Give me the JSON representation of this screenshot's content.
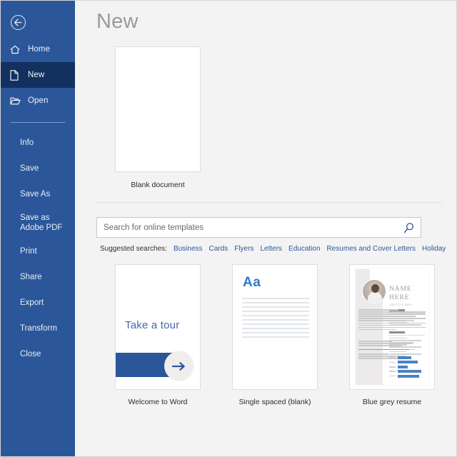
{
  "sidebar": {
    "back": {
      "label": "Back",
      "icon": "back-arrow-icon"
    },
    "main_items": [
      {
        "label": "Home",
        "icon": "home-icon",
        "selected": false
      },
      {
        "label": "New",
        "icon": "new-document-icon",
        "selected": true
      },
      {
        "label": "Open",
        "icon": "open-folder-icon",
        "selected": false
      }
    ],
    "sub_items": [
      {
        "label": "Info"
      },
      {
        "label": "Save"
      },
      {
        "label": "Save As"
      },
      {
        "label": "Save as Adobe PDF"
      },
      {
        "label": "Print"
      },
      {
        "label": "Share"
      },
      {
        "label": "Export"
      },
      {
        "label": "Transform"
      },
      {
        "label": "Close"
      }
    ],
    "accent_color": "#2b579a",
    "selected_color": "#12315e"
  },
  "main": {
    "title": "New",
    "blank_document": {
      "caption": "Blank document"
    },
    "search": {
      "placeholder": "Search for online templates",
      "value": "",
      "icon": "search-icon"
    },
    "suggested": {
      "label": "Suggested searches:",
      "items": [
        "Business",
        "Cards",
        "Flyers",
        "Letters",
        "Education",
        "Resumes and Cover Letters",
        "Holiday"
      ],
      "link_color": "#2b579a"
    },
    "templates": [
      {
        "caption": "Welcome to Word",
        "tour_text": "Take a tour",
        "arrow_icon": "arrow-right-icon"
      },
      {
        "caption": "Single spaced (blank)",
        "sample_text": "Aa"
      },
      {
        "caption": "Blue grey resume",
        "name_line1": "NAME",
        "name_line2": "HERE",
        "subtitle": "JOB TITLE HERE"
      }
    ]
  }
}
